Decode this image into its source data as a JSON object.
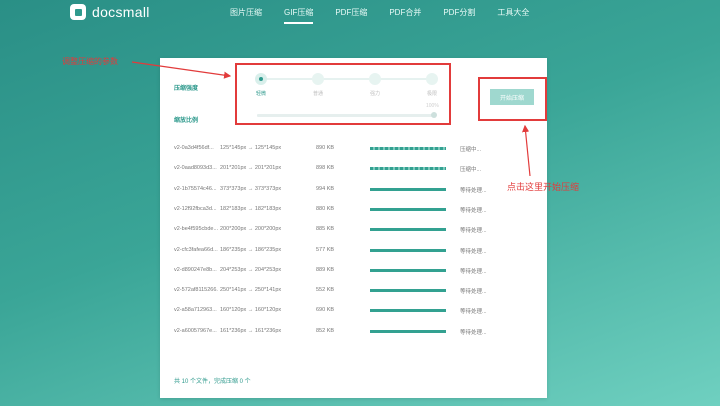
{
  "header": {
    "logo": "docsmall",
    "nav": [
      "图片压缩",
      "GIF压缩",
      "PDF压缩",
      "PDF合并",
      "PDF分割",
      "工具大全"
    ],
    "active_nav": 1
  },
  "settings": {
    "strength_label": "压缩强度",
    "scale_label": "缩放比例",
    "levels": [
      "轻微",
      "普通",
      "强力",
      "极限"
    ],
    "selected_level": 0,
    "scale_percent": "100%",
    "start_button": "开始压缩"
  },
  "files": [
    {
      "name": "v2-0a3d4f56df...",
      "dim": "125*145px → 125*145px",
      "size": "890 KB",
      "progress": 1.0,
      "status": "压缩中..."
    },
    {
      "name": "v2-0aad8093d3...",
      "dim": "201*201px → 201*201px",
      "size": "898 KB",
      "progress": 1.0,
      "status": "压缩中..."
    },
    {
      "name": "v2-1b75574c46...",
      "dim": "373*373px → 373*373px",
      "size": "994 KB",
      "progress": 1.0,
      "status": "等待处理..."
    },
    {
      "name": "v2-12f92fbca3d...",
      "dim": "182*183px → 182*183px",
      "size": "880 KB",
      "progress": 1.0,
      "status": "等待处理..."
    },
    {
      "name": "v2-be4f595cbde...",
      "dim": "200*200px → 200*200px",
      "size": "885 KB",
      "progress": 1.0,
      "status": "等待处理..."
    },
    {
      "name": "v2-cfc3fafea66d...",
      "dim": "186*235px → 186*235px",
      "size": "577 KB",
      "progress": 1.0,
      "status": "等待处理..."
    },
    {
      "name": "v2-d890247e8b...",
      "dim": "204*253px → 204*253px",
      "size": "889 KB",
      "progress": 1.0,
      "status": "等待处理..."
    },
    {
      "name": "v2-572af8115266...",
      "dim": "250*141px → 250*141px",
      "size": "552 KB",
      "progress": 1.0,
      "status": "等待处理..."
    },
    {
      "name": "v2-a58a712963...",
      "dim": "160*120px → 160*120px",
      "size": "690 KB",
      "progress": 1.0,
      "status": "等待处理..."
    },
    {
      "name": "v2-a60057967e...",
      "dim": "161*236px → 161*236px",
      "size": "852 KB",
      "progress": 1.0,
      "status": "等待处理..."
    }
  ],
  "summary": "共 10 个文件，完成压缩 0 个",
  "annotations": {
    "left": "调整压缩的参数",
    "right": "点击这里开始压缩"
  },
  "colors": {
    "accent": "#2f9a8d",
    "annotation": "#e23b3b"
  }
}
